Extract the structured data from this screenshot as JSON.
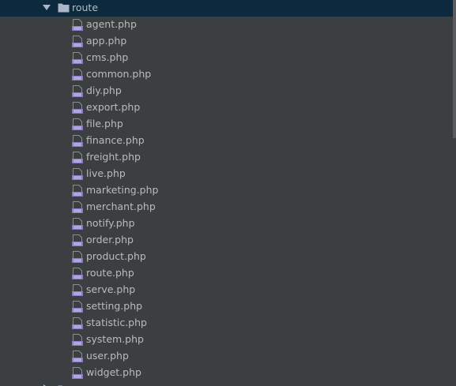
{
  "tree": {
    "folder": {
      "label": "route",
      "icon": "folder-icon",
      "expanded": true
    },
    "files": [
      {
        "label": "agent.php",
        "icon": "php-file-icon"
      },
      {
        "label": "app.php",
        "icon": "php-file-icon"
      },
      {
        "label": "cms.php",
        "icon": "php-file-icon"
      },
      {
        "label": "common.php",
        "icon": "php-file-icon"
      },
      {
        "label": "diy.php",
        "icon": "php-file-icon"
      },
      {
        "label": "export.php",
        "icon": "php-file-icon"
      },
      {
        "label": "file.php",
        "icon": "php-file-icon"
      },
      {
        "label": "finance.php",
        "icon": "php-file-icon"
      },
      {
        "label": "freight.php",
        "icon": "php-file-icon"
      },
      {
        "label": "live.php",
        "icon": "php-file-icon"
      },
      {
        "label": "marketing.php",
        "icon": "php-file-icon"
      },
      {
        "label": "merchant.php",
        "icon": "php-file-icon"
      },
      {
        "label": "notify.php",
        "icon": "php-file-icon"
      },
      {
        "label": "order.php",
        "icon": "php-file-icon"
      },
      {
        "label": "product.php",
        "icon": "php-file-icon"
      },
      {
        "label": "route.php",
        "icon": "php-file-icon"
      },
      {
        "label": "serve.php",
        "icon": "php-file-icon"
      },
      {
        "label": "setting.php",
        "icon": "php-file-icon"
      },
      {
        "label": "statistic.php",
        "icon": "php-file-icon"
      },
      {
        "label": "system.php",
        "icon": "php-file-icon"
      },
      {
        "label": "user.php",
        "icon": "php-file-icon"
      },
      {
        "label": "widget.php",
        "icon": "php-file-icon"
      }
    ]
  },
  "colors": {
    "background": "#3c3f41",
    "selected_row": "#0d293e",
    "text": "#bbbbbb",
    "php_icon": "#8a7bc4",
    "folder_icon": "#a9b7c6"
  }
}
